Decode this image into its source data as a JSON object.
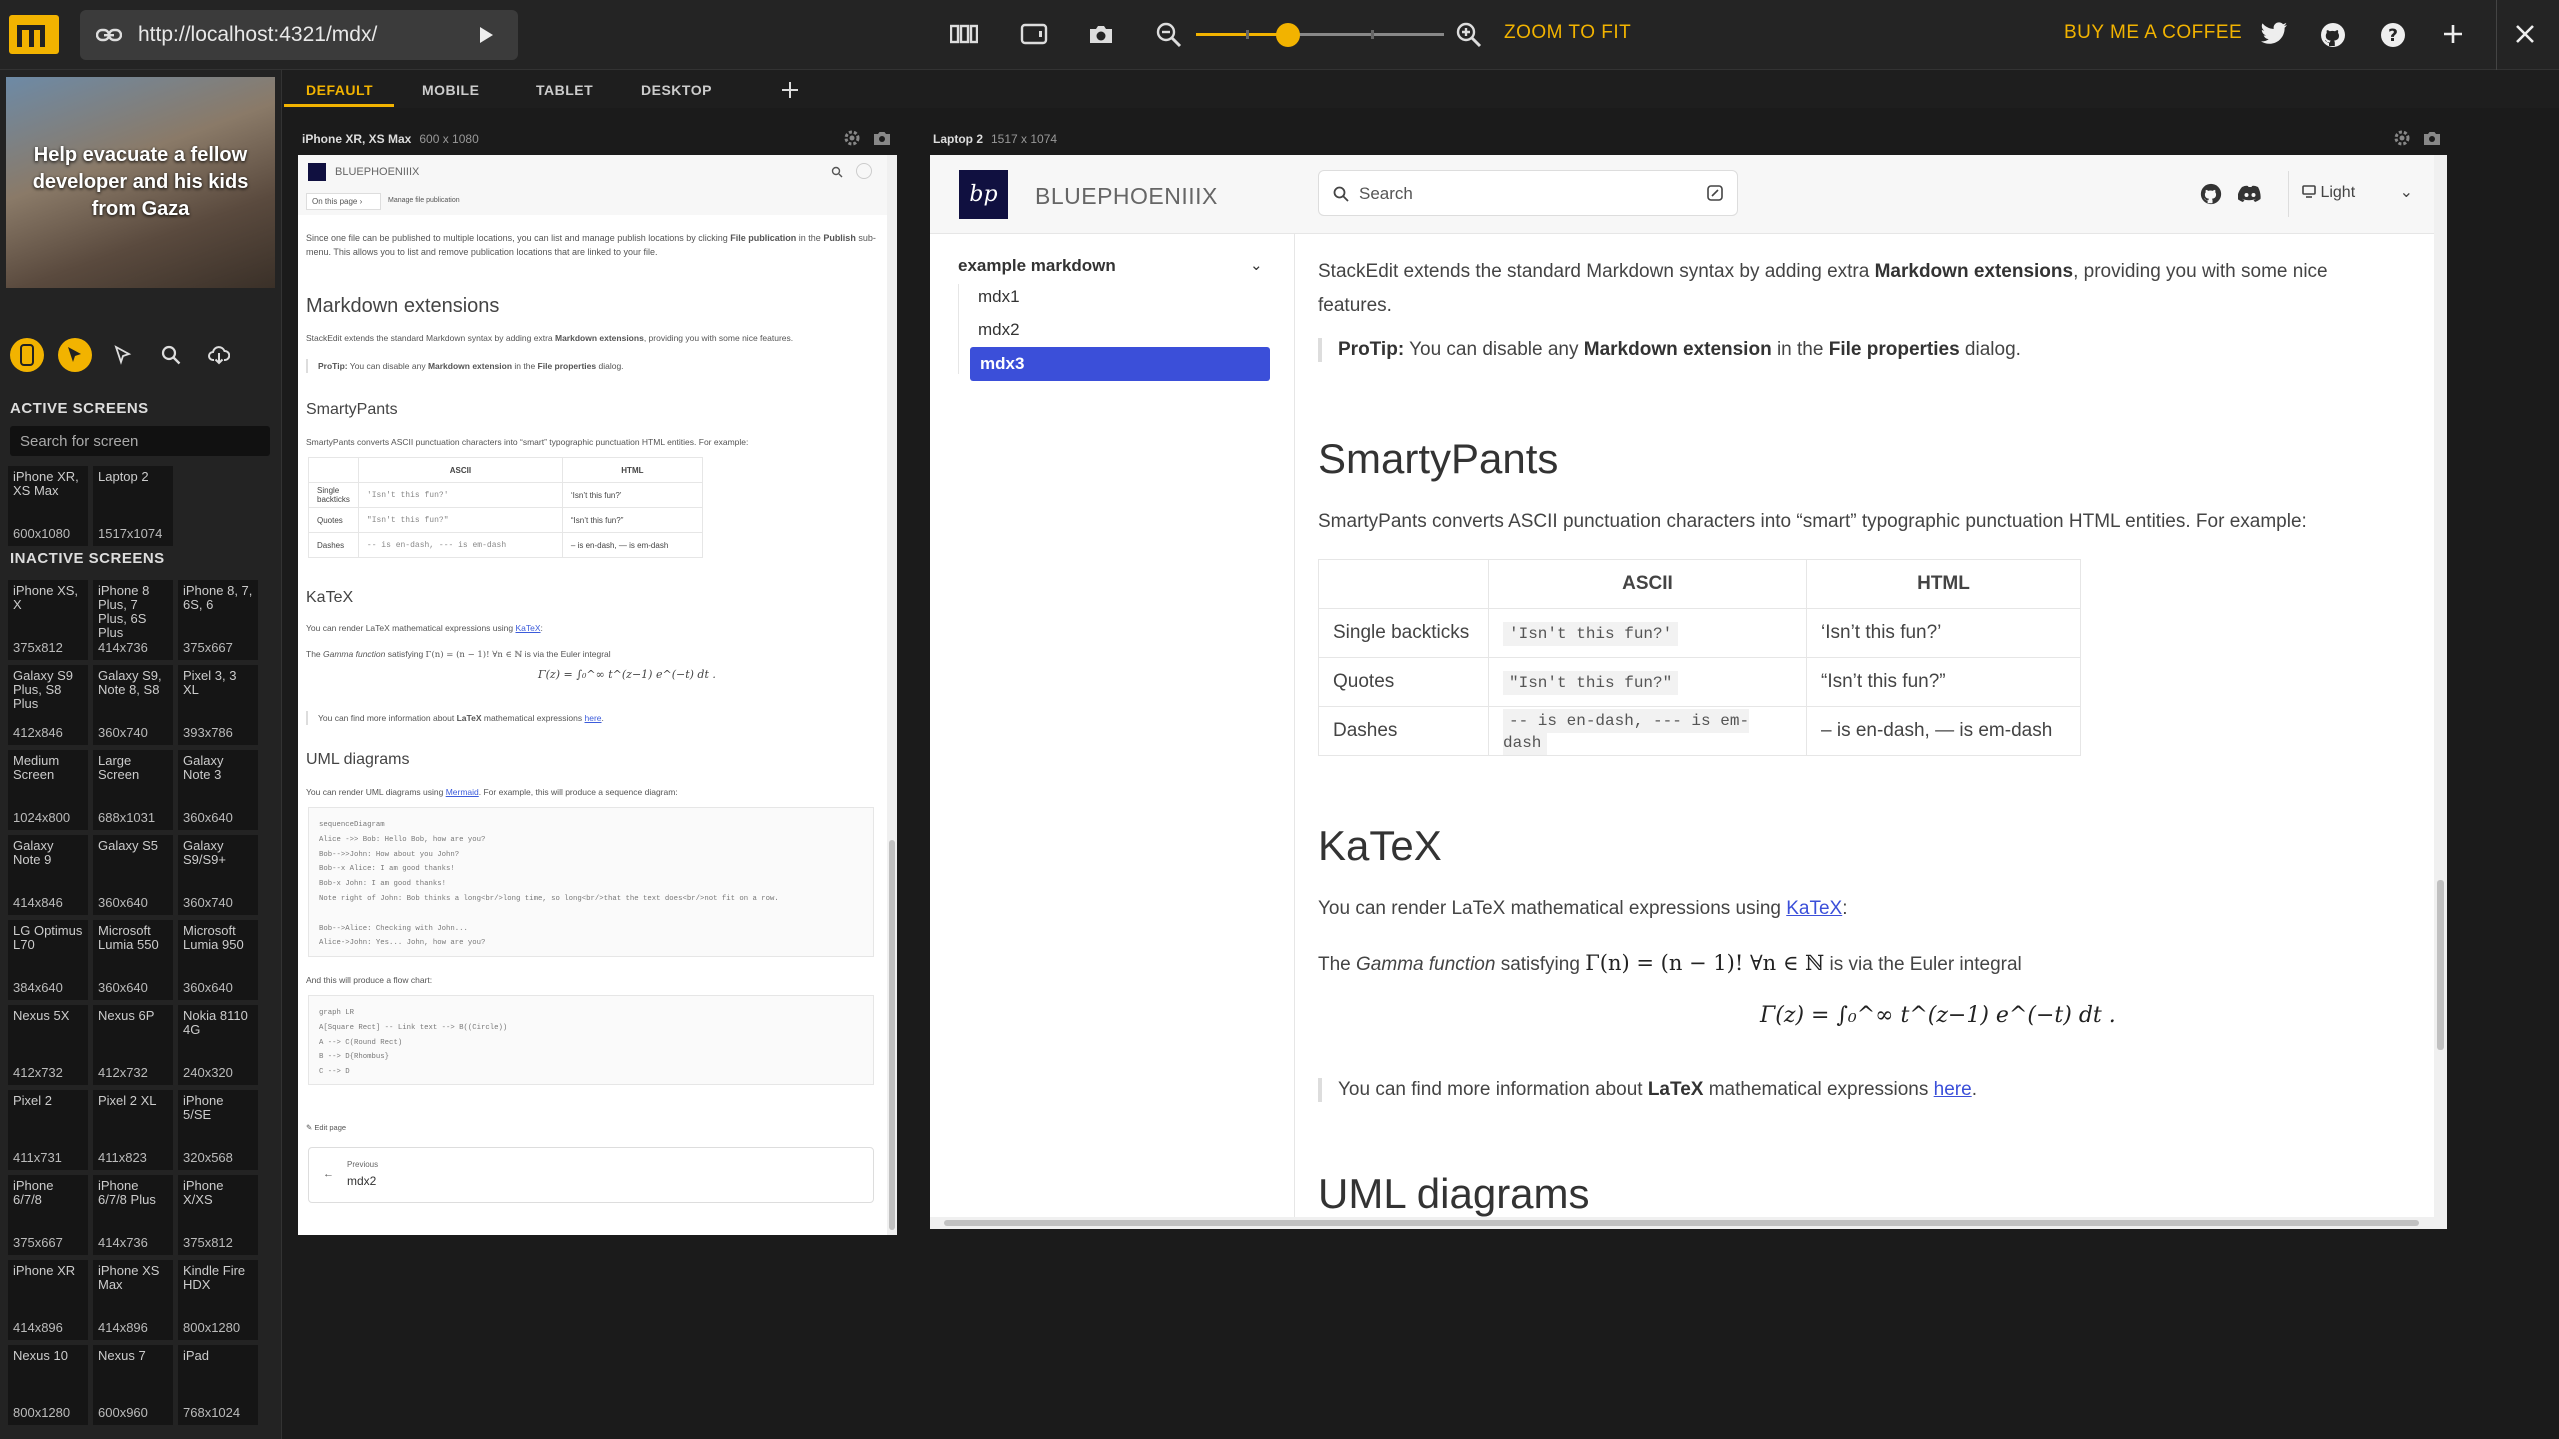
{
  "toolbar": {
    "url": "http://localhost:4321/mdx/",
    "zoom_to_fit": "ZOOM TO FIT",
    "buy_me_coffee": "BUY ME A COFFEE",
    "accent_color": "#f2b300"
  },
  "sidebar": {
    "banner_text": "Help evacuate a fellow developer and his kids from Gaza",
    "active_heading": "ACTIVE SCREENS",
    "search_placeholder": "Search for screen",
    "inactive_heading": "INACTIVE SCREENS",
    "active_screens": [
      {
        "name": "iPhone XR, XS Max",
        "res": "600x1080"
      },
      {
        "name": "Laptop 2",
        "res": "1517x1074"
      }
    ],
    "inactive_screens": [
      {
        "name": "iPhone XS, X",
        "res": "375x812"
      },
      {
        "name": "iPhone 8 Plus, 7 Plus, 6S Plus",
        "res": "414x736"
      },
      {
        "name": "iPhone 8, 7, 6S, 6",
        "res": "375x667"
      },
      {
        "name": "Galaxy S9 Plus, S8 Plus",
        "res": "412x846"
      },
      {
        "name": "Galaxy S9, Note 8, S8",
        "res": "360x740"
      },
      {
        "name": "Pixel 3, 3 XL",
        "res": "393x786"
      },
      {
        "name": "Medium Screen",
        "res": "1024x800"
      },
      {
        "name": "Large Screen",
        "res": "688x1031"
      },
      {
        "name": "Galaxy Note 3",
        "res": "360x640"
      },
      {
        "name": "Galaxy Note 9",
        "res": "414x846"
      },
      {
        "name": "Galaxy S5",
        "res": "360x640"
      },
      {
        "name": "Galaxy S9/S9+",
        "res": "360x740"
      },
      {
        "name": "LG Optimus L70",
        "res": "384x640"
      },
      {
        "name": "Microsoft Lumia 550",
        "res": "360x640"
      },
      {
        "name": "Microsoft Lumia 950",
        "res": "360x640"
      },
      {
        "name": "Nexus 5X",
        "res": "412x732"
      },
      {
        "name": "Nexus 6P",
        "res": "412x732"
      },
      {
        "name": "Nokia 8110 4G",
        "res": "240x320"
      },
      {
        "name": "Pixel 2",
        "res": "411x731"
      },
      {
        "name": "Pixel 2 XL",
        "res": "411x823"
      },
      {
        "name": "iPhone 5/SE",
        "res": "320x568"
      },
      {
        "name": "iPhone 6/7/8",
        "res": "375x667"
      },
      {
        "name": "iPhone 6/7/8 Plus",
        "res": "414x736"
      },
      {
        "name": "iPhone X/XS",
        "res": "375x812"
      },
      {
        "name": "iPhone XR",
        "res": "414x896"
      },
      {
        "name": "iPhone XS Max",
        "res": "414x896"
      },
      {
        "name": "Kindle Fire HDX",
        "res": "800x1280"
      },
      {
        "name": "Nexus 10",
        "res": "800x1280"
      },
      {
        "name": "Nexus 7",
        "res": "600x960"
      },
      {
        "name": "iPad",
        "res": "768x1024"
      }
    ]
  },
  "tabs": [
    "DEFAULT",
    "MOBILE",
    "TABLET",
    "DESKTOP"
  ],
  "phone": {
    "label": "iPhone XR, XS Max",
    "dims": "600 x 1080",
    "brand": "BLUEPHOENIIIX",
    "on_this_page": "On this page",
    "manage_pub": "Manage file publication",
    "intro_before": "Since one file can be published to multiple locations, you can list and manage publish locations by clicking ",
    "intro_bold1": "File publication",
    "intro_mid": " in the ",
    "intro_bold2": "Publish",
    "intro_after": " sub-menu. This allows you to list and remove publication locations that are linked to your file.",
    "h_md_ext": "Markdown extensions",
    "md_ext_p1": "StackEdit extends the standard Markdown syntax by adding extra ",
    "md_ext_bold": "Markdown extensions",
    "md_ext_p2": ", providing you with some nice features.",
    "protip_bold": "ProTip:",
    "protip_p1": " You can disable any ",
    "protip_bold2": "Markdown extension",
    "protip_p2": " in the ",
    "protip_bold3": "File properties",
    "protip_p3": " dialog.",
    "h_smarty": "SmartyPants",
    "smarty_p": "SmartyPants converts ASCII punctuation characters into “smart” typographic punctuation HTML entities. For example:",
    "h_katex": "KaTeX",
    "katex_p1": "You can render LaTeX mathematical expressions using ",
    "katex_link": "KaTeX",
    "katex_p2": ":",
    "gamma_p1": "The ",
    "gamma_em": "Gamma function",
    "gamma_p2": " satisfying ",
    "gamma_math": "Γ(n) = (n − 1)!   ∀n ∈ ℕ",
    "gamma_p3": " is via the Euler integral",
    "katex_more_p1": "You can find more information about ",
    "katex_more_bold": "LaTeX",
    "katex_more_p2": " mathematical expressions ",
    "katex_more_link": "here",
    "katex_more_p3": ".",
    "h_uml": "UML diagrams",
    "uml_p1": "You can render UML diagrams using ",
    "uml_link": "Mermaid",
    "uml_p2": ". For example, this will produce a sequence diagram:",
    "seq_code": [
      "sequenceDiagram",
      "Alice ->> Bob: Hello Bob, how are you?",
      "Bob-->>John: How about you John?",
      "Bob--x Alice: I am good thanks!",
      "Bob-x John: I am good thanks!",
      "Note right of John: Bob thinks a long<br/>long time, so long<br/>that the text does<br/>not fit on a row.",
      "",
      "Bob-->Alice: Checking with John...",
      "Alice->John: Yes... John, how are you?"
    ],
    "flow_intro": "And this will produce a flow chart:",
    "flow_code": [
      "graph LR",
      "A[Square Rect] -- Link text --> B((Circle))",
      "A --> C(Round Rect)",
      "B --> D{Rhombus}",
      "C --> D"
    ],
    "edit_page": "Edit page",
    "prev_label": "Previous",
    "prev_link": "mdx2"
  },
  "laptop": {
    "label": "Laptop 2",
    "dims": "1517 x 1074",
    "brand": "BLUEPHOENIIIX",
    "search_placeholder": "Search",
    "theme": "Light",
    "nav_group": "example markdown",
    "nav_items": [
      "mdx1",
      "mdx2",
      "mdx3"
    ],
    "intro_p1": "StackEdit extends the standard Markdown syntax by adding extra ",
    "intro_bold": "Markdown extensions",
    "intro_p2": ", providing you with some nice features.",
    "protip_bold": "ProTip:",
    "protip_p1": " You can disable any ",
    "protip_bold2": "Markdown extension",
    "protip_p2": " in the ",
    "protip_bold3": "File properties",
    "protip_p3": " dialog.",
    "h_smarty": "SmartyPants",
    "smarty_p": "SmartyPants converts ASCII punctuation characters into “smart” typographic punctuation HTML entities. For example:",
    "table": {
      "headers": [
        "",
        "ASCII",
        "HTML"
      ],
      "rows": [
        [
          "Single backticks",
          "'Isn't this fun?'",
          "‘Isn’t this fun?’"
        ],
        [
          "Quotes",
          "\"Isn't this fun?\"",
          "“Isn’t this fun?”"
        ],
        [
          "Dashes",
          "-- is en-dash, --- is em-dash",
          "– is en-dash, — is em-dash"
        ]
      ]
    },
    "h_katex": "KaTeX",
    "katex_p1": "You can render LaTeX mathematical expressions using ",
    "katex_link": "KaTeX",
    "katex_p2": ":",
    "gamma_p1": "The ",
    "gamma_em": "Gamma function",
    "gamma_p2": " satisfying ",
    "gamma_math": "Γ(n) = (n − 1)!   ∀n ∈ ℕ",
    "gamma_p3": " is via the Euler integral",
    "integral": "Γ(z) = ∫₀^∞ t^(z−1) e^(−t) dt .",
    "katex_more_p1": "You can find more information about ",
    "katex_more_bold": "LaTeX",
    "katex_more_p2": " mathematical expressions ",
    "katex_more_link": "here",
    "katex_more_p3": ".",
    "h_uml": "UML diagrams"
  }
}
